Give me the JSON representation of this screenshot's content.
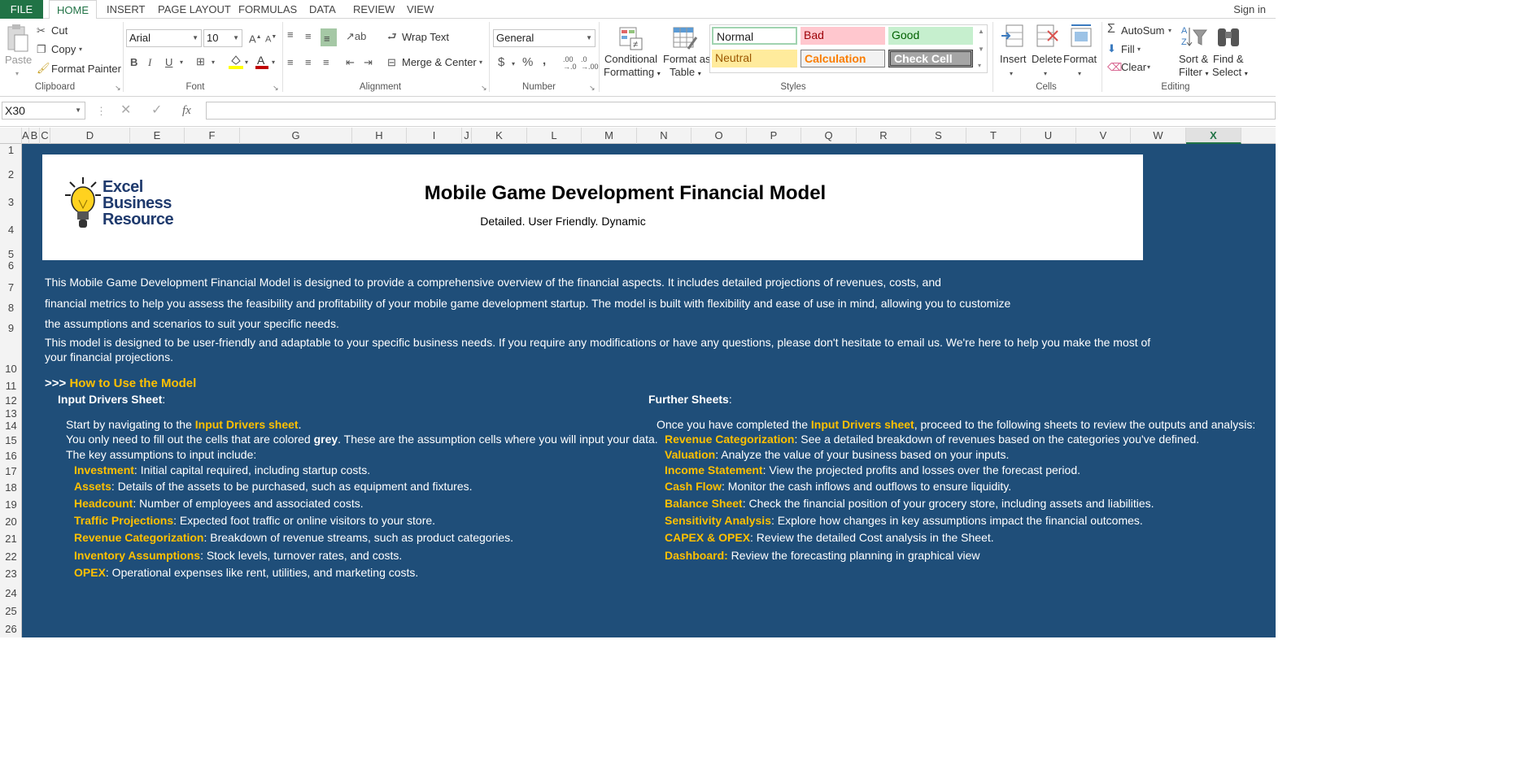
{
  "tabs": {
    "file": "FILE",
    "items": [
      "HOME",
      "INSERT",
      "PAGE LAYOUT",
      "FORMULAS",
      "DATA",
      "REVIEW",
      "VIEW"
    ],
    "active": "HOME",
    "sign_in": "Sign in"
  },
  "ribbon": {
    "clipboard": {
      "paste": "Paste",
      "cut": "Cut",
      "copy": "Copy",
      "format_painter": "Format Painter",
      "label": "Clipboard"
    },
    "font": {
      "name": "Arial",
      "size": "10",
      "label": "Font"
    },
    "alignment": {
      "wrap_text": "Wrap Text",
      "merge_center": "Merge & Center",
      "label": "Alignment"
    },
    "number": {
      "format": "General",
      "label": "Number"
    },
    "styles": {
      "conditional": [
        "Conditional",
        "Formatting"
      ],
      "format_table": [
        "Format as",
        "Table"
      ],
      "cells": [
        {
          "name": "Normal",
          "bg": "#ffffff",
          "fg": "#000000"
        },
        {
          "name": "Bad",
          "bg": "#ffc7ce",
          "fg": "#9c0006"
        },
        {
          "name": "Good",
          "bg": "#c6efce",
          "fg": "#006100"
        },
        {
          "name": "Neutral",
          "bg": "#ffeb9c",
          "fg": "#9c5700"
        },
        {
          "name": "Calculation",
          "bg": "#f2f2f2",
          "fg": "#fa7d00"
        },
        {
          "name": "Check Cell",
          "bg": "#a5a5a5",
          "fg": "#ffffff"
        }
      ],
      "label": "Styles"
    },
    "cells": {
      "insert": "Insert",
      "delete": "Delete",
      "format": "Format",
      "label": "Cells"
    },
    "editing": {
      "autosum": "AutoSum",
      "fill": "Fill",
      "clear": "Clear",
      "sort": [
        "Sort &",
        "Filter"
      ],
      "find": [
        "Find &",
        "Select"
      ],
      "label": "Editing"
    }
  },
  "formula_bar": {
    "name_box": "X30",
    "fx": "fx",
    "value": ""
  },
  "columns": [
    "A",
    "B",
    "C",
    "D",
    "E",
    "F",
    "G",
    "H",
    "I",
    "J",
    "K",
    "L",
    "M",
    "N",
    "O",
    "P",
    "Q",
    "R",
    "S",
    "T",
    "U",
    "V",
    "W",
    "X"
  ],
  "selected_column": "X",
  "rows": [
    "1",
    "2",
    "3",
    "4",
    "5",
    "6",
    "7",
    "8",
    "9",
    "10",
    "11",
    "12",
    "13",
    "14",
    "15",
    "16",
    "17",
    "18",
    "19",
    "20",
    "21",
    "22",
    "23",
    "24",
    "25",
    "26"
  ],
  "sheet": {
    "logo": [
      "Excel",
      "Business",
      "Resource"
    ],
    "title": "Mobile Game Development Financial Model",
    "subtitle": "Detailed. User Friendly. Dynamic",
    "intro": [
      "This Mobile Game Development Financial Model is designed to provide a comprehensive overview of the financial aspects. It includes detailed projections of revenues, costs, and",
      "financial metrics to help you assess the feasibility and profitability of your mobile game development startup. The model is built with flexibility and ease of use in mind, allowing you to customize",
      "the assumptions and scenarios to suit your specific needs.",
      "This model is designed to be user-friendly and adaptable to your specific business needs. If you require any modifications or have any questions, please don't hesitate to email us. We're here to help you make the most of",
      "your financial projections."
    ],
    "howto_prefix": ">>>",
    "howto_title": "How to Use the Model",
    "left": {
      "heading": "Input Drivers Sheet",
      "colon": ":",
      "start_a": "Start by navigating to the ",
      "start_link": "Input Drivers sheet",
      "start_b": ".",
      "grey_a": "You only need to fill out the cells that are colored ",
      "grey_bold": "grey",
      "grey_b": ". These are the assumption cells where you will input your data.",
      "key": "The key assumptions to input include:",
      "items": [
        {
          "name": "Investment",
          "desc": ": Initial capital required, including startup costs."
        },
        {
          "name": "Assets",
          "desc": ": Details of the assets to be purchased, such as equipment and fixtures."
        },
        {
          "name": "Headcount",
          "desc": ": Number of employees and associated costs."
        },
        {
          "name": "Traffic Projections",
          "desc": ": Expected foot traffic or online visitors to your store."
        },
        {
          "name": "Revenue Categorization",
          "desc": ": Breakdown of revenue streams, such as product categories."
        },
        {
          "name": "Inventory Assumptions",
          "desc": ": Stock levels, turnover rates, and costs."
        },
        {
          "name": "OPEX",
          "desc": ": Operational expenses like rent, utilities, and marketing costs."
        }
      ]
    },
    "right": {
      "heading": "Further Sheets",
      "colon": ":",
      "intro_a": "Once you have completed the ",
      "intro_link": "Input Drivers sheet",
      "intro_b": ", proceed to the following sheets to review the outputs and analysis:",
      "items": [
        {
          "name": "Revenue Categorization",
          "desc": ": See a detailed breakdown of revenues based on the categories you've defined."
        },
        {
          "name": "Valuation",
          "desc": ": Analyze the value of your business based on your inputs."
        },
        {
          "name": "Income Statement",
          "desc": ": View the projected profits and losses over the forecast period."
        },
        {
          "name": "Cash Flow",
          "desc": ": Monitor the cash inflows and outflows to ensure liquidity."
        },
        {
          "name": "Balance Sheet",
          "desc": ": Check the financial position of your grocery store, including assets and liabilities."
        },
        {
          "name": "Sensitivity Analysis",
          "desc": ": Explore how changes in key assumptions impact the financial outcomes."
        },
        {
          "name": "CAPEX & OPEX",
          "desc": ": Review the detailed Cost analysis in the Sheet."
        },
        {
          "name": "Dashboard:",
          "desc": " Review the forecasting planning in graphical view"
        }
      ]
    }
  }
}
